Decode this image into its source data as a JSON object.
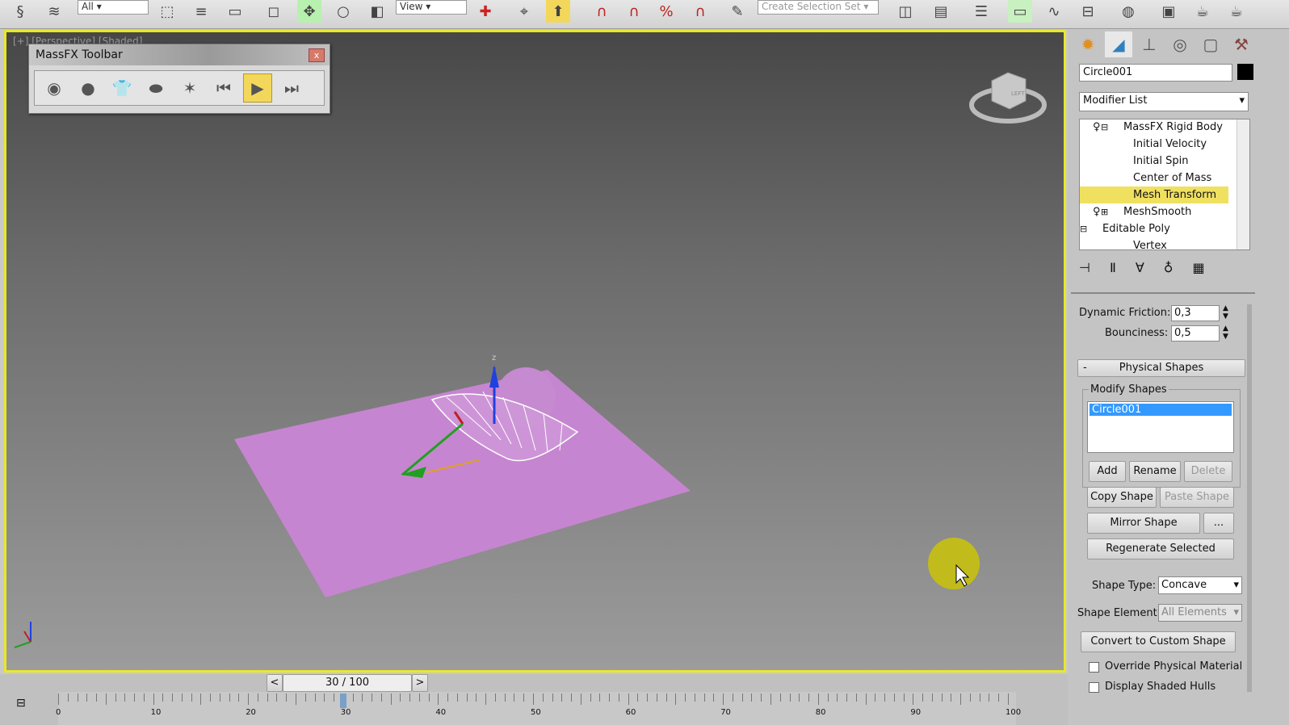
{
  "toolbar": {
    "selection_filter": "All",
    "ref_coord": "View",
    "selection_set_placeholder": "Create Selection Set"
  },
  "viewport": {
    "label": "[+] [Perspective] [Shaded]",
    "viewcube_face": "LEFT"
  },
  "massfx": {
    "title": "MassFX Toolbar",
    "close": "x"
  },
  "panel": {
    "object_name": "Circle001",
    "modifier_list": "Modifier List",
    "stack": [
      {
        "label": "MassFX Rigid Body",
        "level": 0,
        "expand": "-"
      },
      {
        "label": "Initial Velocity",
        "level": 1
      },
      {
        "label": "Initial Spin",
        "level": 1
      },
      {
        "label": "Center of Mass",
        "level": 1
      },
      {
        "label": "Mesh Transform",
        "level": 1,
        "selected": true
      },
      {
        "label": "MeshSmooth",
        "level": 0,
        "expand": "+"
      },
      {
        "label": "Editable Poly",
        "level": 0,
        "expand": "-"
      },
      {
        "label": "Vertex",
        "level": 1
      }
    ],
    "dynamic_friction_label": "Dynamic Friction:",
    "dynamic_friction": "0,3",
    "bounciness_label": "Bounciness:",
    "bounciness": "0,5",
    "rollout_toggle": "-",
    "physical_shapes": "Physical Shapes",
    "modify_shapes": "Modify Shapes",
    "shapes": [
      "Circle001"
    ],
    "add": "Add",
    "rename": "Rename",
    "delete": "Delete",
    "copy_shape": "Copy Shape",
    "paste_shape": "Paste Shape",
    "mirror_shape": "Mirror Shape",
    "more": "...",
    "regenerate": "Regenerate Selected",
    "shape_type_label": "Shape Type:",
    "shape_type": "Concave",
    "shape_element_label": "Shape Element:",
    "shape_element": "All Elements",
    "convert": "Convert to Custom Shape",
    "override": "Override Physical Material",
    "display_hulls": "Display Shaded Hulls"
  },
  "timeline": {
    "frame": "30 / 100",
    "prev": "<",
    "next": ">",
    "ticks": [
      "0",
      "10",
      "20",
      "30",
      "40",
      "50",
      "60",
      "70",
      "80",
      "90",
      "100"
    ],
    "current_frame": 30,
    "total_frames": 100
  }
}
